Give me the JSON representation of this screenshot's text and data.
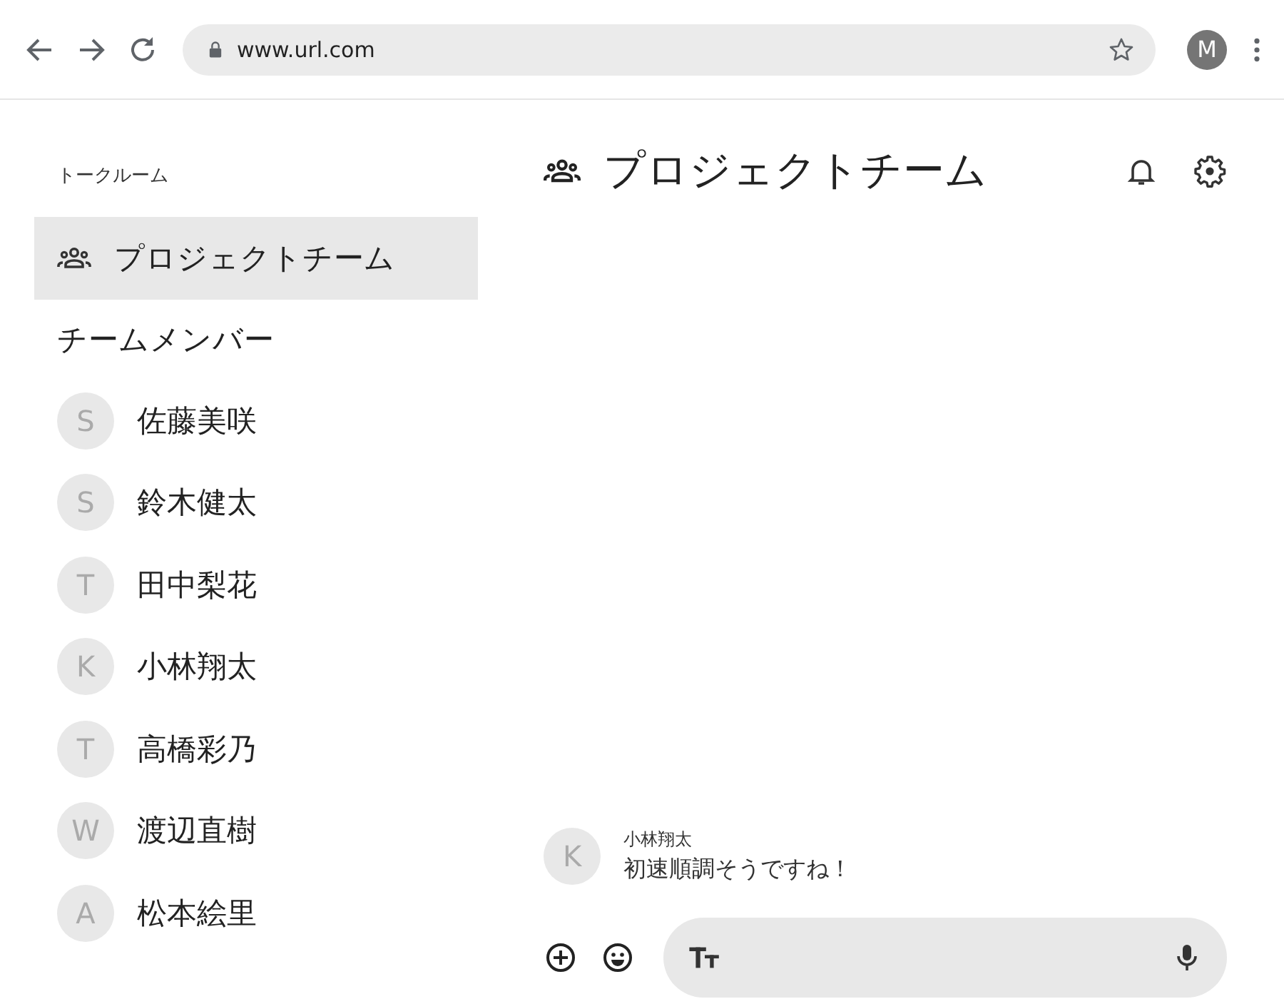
{
  "browser": {
    "url": "www.url.com",
    "profile_initial": "M"
  },
  "sidebar": {
    "section_title": "トークルーム",
    "rooms": [
      {
        "name": "プロジェクトチーム",
        "selected": true
      }
    ],
    "members_title": "チームメンバー",
    "members": [
      {
        "initial": "S",
        "name": "佐藤美咲"
      },
      {
        "initial": "S",
        "name": "鈴木健太"
      },
      {
        "initial": "T",
        "name": "田中梨花"
      },
      {
        "initial": "K",
        "name": "小林翔太"
      },
      {
        "initial": "T",
        "name": "高橋彩乃"
      },
      {
        "initial": "W",
        "name": "渡辺直樹"
      },
      {
        "initial": "A",
        "name": "松本絵里"
      }
    ]
  },
  "chat": {
    "title": "プロジェクトチーム",
    "messages": [
      {
        "initial": "K",
        "sender": "小林翔太",
        "text": "初速順調そうですね！"
      }
    ]
  }
}
